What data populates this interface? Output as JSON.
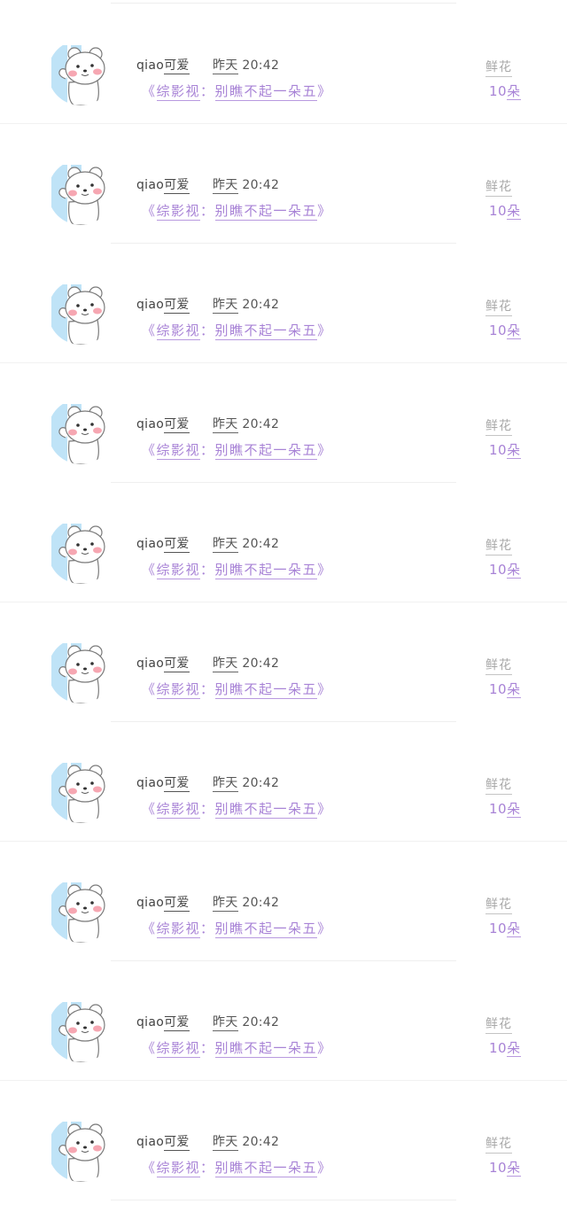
{
  "rows": [
    {
      "username_prefix": "qiao",
      "username_suffix": "可爱",
      "time_day": "昨天",
      "time_clock": "20:42",
      "open_quote": "《",
      "category": "综影视",
      "colon": "：",
      "book_title": "别瞧不起一朵五",
      "close_quote": "》",
      "gift_label": "鲜花",
      "gift_count": "10",
      "gift_unit": "朵"
    },
    {
      "username_prefix": "qiao",
      "username_suffix": "可爱",
      "time_day": "昨天",
      "time_clock": "20:42",
      "open_quote": "《",
      "category": "综影视",
      "colon": "：",
      "book_title": "别瞧不起一朵五",
      "close_quote": "》",
      "gift_label": "鲜花",
      "gift_count": "10",
      "gift_unit": "朵"
    },
    {
      "username_prefix": "qiao",
      "username_suffix": "可爱",
      "time_day": "昨天",
      "time_clock": "20:42",
      "open_quote": "《",
      "category": "综影视",
      "colon": "：",
      "book_title": "别瞧不起一朵五",
      "close_quote": "》",
      "gift_label": "鲜花",
      "gift_count": "10",
      "gift_unit": "朵"
    },
    {
      "username_prefix": "qiao",
      "username_suffix": "可爱",
      "time_day": "昨天",
      "time_clock": "20:42",
      "open_quote": "《",
      "category": "综影视",
      "colon": "：",
      "book_title": "别瞧不起一朵五",
      "close_quote": "》",
      "gift_label": "鲜花",
      "gift_count": "10",
      "gift_unit": "朵"
    },
    {
      "username_prefix": "qiao",
      "username_suffix": "可爱",
      "time_day": "昨天",
      "time_clock": "20:42",
      "open_quote": "《",
      "category": "综影视",
      "colon": "：",
      "book_title": "别瞧不起一朵五",
      "close_quote": "》",
      "gift_label": "鲜花",
      "gift_count": "10",
      "gift_unit": "朵"
    },
    {
      "username_prefix": "qiao",
      "username_suffix": "可爱",
      "time_day": "昨天",
      "time_clock": "20:42",
      "open_quote": "《",
      "category": "综影视",
      "colon": "：",
      "book_title": "别瞧不起一朵五",
      "close_quote": "》",
      "gift_label": "鲜花",
      "gift_count": "10",
      "gift_unit": "朵"
    },
    {
      "username_prefix": "qiao",
      "username_suffix": "可爱",
      "time_day": "昨天",
      "time_clock": "20:42",
      "open_quote": "《",
      "category": "综影视",
      "colon": "：",
      "book_title": "别瞧不起一朵五",
      "close_quote": "》",
      "gift_label": "鲜花",
      "gift_count": "10",
      "gift_unit": "朵"
    },
    {
      "username_prefix": "qiao",
      "username_suffix": "可爱",
      "time_day": "昨天",
      "time_clock": "20:42",
      "open_quote": "《",
      "category": "综影视",
      "colon": "：",
      "book_title": "别瞧不起一朵五",
      "close_quote": "》",
      "gift_label": "鲜花",
      "gift_count": "10",
      "gift_unit": "朵"
    },
    {
      "username_prefix": "qiao",
      "username_suffix": "可爱",
      "time_day": "昨天",
      "time_clock": "20:42",
      "open_quote": "《",
      "category": "综影视",
      "colon": "：",
      "book_title": "别瞧不起一朵五",
      "close_quote": "》",
      "gift_label": "鲜花",
      "gift_count": "10",
      "gift_unit": "朵"
    },
    {
      "username_prefix": "qiao",
      "username_suffix": "可爱",
      "time_day": "昨天",
      "time_clock": "20:42",
      "open_quote": "《",
      "category": "综影视",
      "colon": "：",
      "book_title": "别瞧不起一朵五",
      "close_quote": "》",
      "gift_label": "鲜花",
      "gift_count": "10",
      "gift_unit": "朵"
    }
  ],
  "avatar": {
    "icon": "bear-avatar-icon",
    "accent_color": "#bfe3f7",
    "cheek_color": "#f6a7b2"
  },
  "colors": {
    "username": "#444444",
    "time": "#555555",
    "link": "#a883d6",
    "gift_label": "#a8a8a8"
  }
}
